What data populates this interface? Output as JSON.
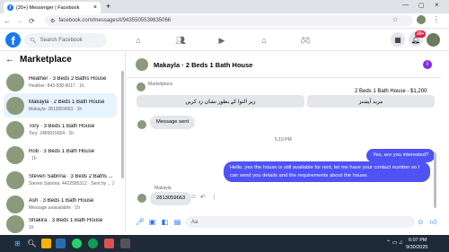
{
  "browser": {
    "tab_title": "(20+) Messenger | Facebook",
    "tab_close": "×",
    "new_tab": "+",
    "url": "facebook.com/messages/t/9435505539835066",
    "back": "←",
    "forward": "→",
    "reload": "⟳",
    "zoom_icon_label": "⊡",
    "star": "☆"
  },
  "header": {
    "logo": "f",
    "search_placeholder": "Search Facebook",
    "notification_count": "20+"
  },
  "sidebar": {
    "title": "Marketplace",
    "back": "←",
    "conversations": [
      {
        "name": "Heather · 3 Beds 2 Baths House",
        "sub": "Heather: 843-508-6017 · 1h"
      },
      {
        "name": "Makayla · 2 Beds 1 Bath House",
        "sub": "Makayla: 2813059663 · 1h"
      },
      {
        "name": "Tory · 3 Beds 1 Bath House",
        "sub": "Tory: 2489915654 · 1h"
      },
      {
        "name": "Rob · 3 Beds 1 Bath House",
        "sub": "· 1h"
      },
      {
        "name": "Steven Sabrina · 3 Beds 2 Baths ...",
        "sub": "Steven Sabrina: 4422585312 · Sent by ... 2h"
      },
      {
        "name": "Ash · 3 Beds 1 Bath House",
        "sub": "Message unavailable · 1h"
      },
      {
        "name": "Shakira · 3 Beds 1 Bath House",
        "sub": "1h"
      }
    ]
  },
  "chat": {
    "title": "Makayla · 2 Beds 1 Bath House",
    "marketplace_label": "Marketplace",
    "listing": "2 Beds 1 Bath House - $1,200",
    "quick_replies": [
      "مزید آپشنز",
      "زیر التوا کے بطور نشان زد کریں"
    ],
    "message_sent": "Message sent",
    "time": "5:19 PM",
    "out_msg_1": "Yes, are you interested?",
    "out_msg_2": "Hello, yes the house is still available for rent, let me have your contact number so I can send you details and the requirements about the house.",
    "sender_name": "Makayla",
    "in_msg": "2813059663",
    "composer_placeholder": "Aa"
  },
  "taskbar": {
    "time": "6:07 PM",
    "date": "9/30/2025",
    "search": "Search"
  }
}
